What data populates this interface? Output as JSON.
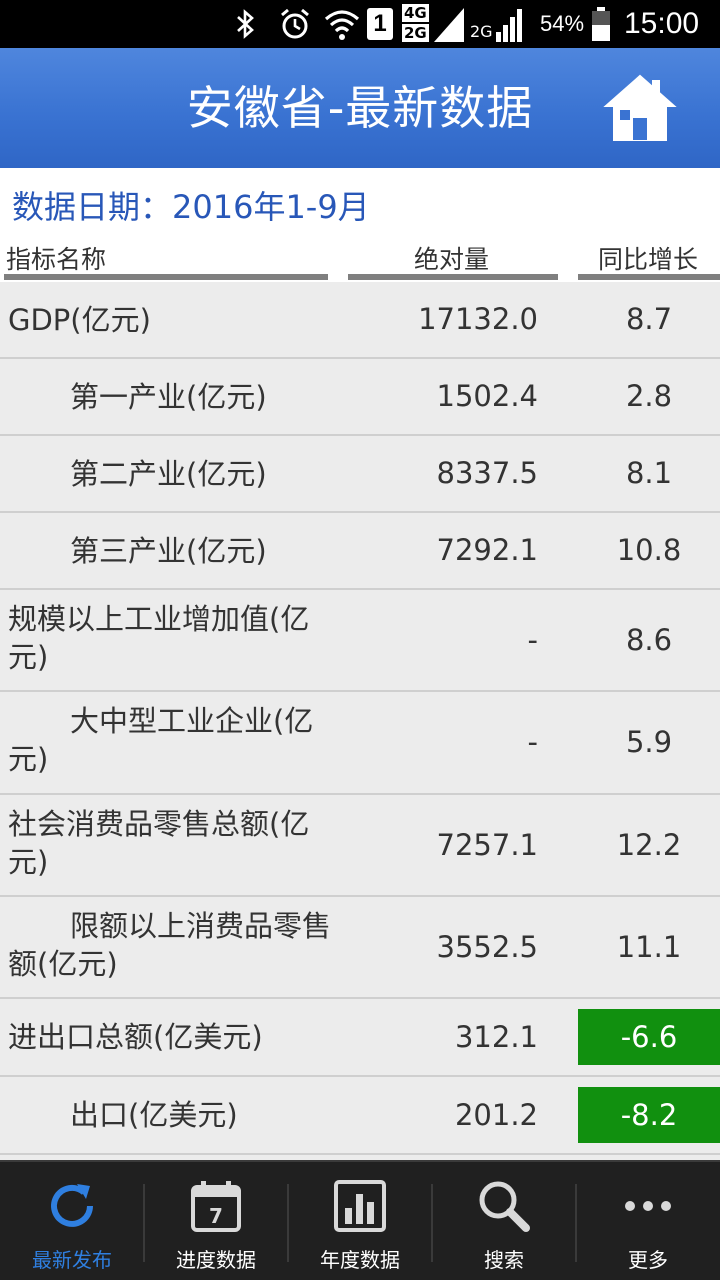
{
  "status_bar": {
    "battery": "54%",
    "time": "15:00",
    "sim_slot": "1",
    "network_top": "4G",
    "network_bottom": "2G",
    "network_2": "2G"
  },
  "header": {
    "title": "安徽省-最新数据",
    "home_icon": "home-icon"
  },
  "date_line": "数据日期：2016年1-9月",
  "columns": {
    "name": "指标名称",
    "value": "绝对量",
    "growth": "同比增长"
  },
  "rows": [
    {
      "name": "GDP(亿元)",
      "value": "17132.0",
      "growth": "8.7",
      "indent": false,
      "negative": false
    },
    {
      "name": "第一产业(亿元)",
      "value": "1502.4",
      "growth": "2.8",
      "indent": true,
      "negative": false
    },
    {
      "name": "第二产业(亿元)",
      "value": "8337.5",
      "growth": "8.1",
      "indent": true,
      "negative": false
    },
    {
      "name": "第三产业(亿元)",
      "value": "7292.1",
      "growth": "10.8",
      "indent": true,
      "negative": false
    },
    {
      "name": "规模以上工业增加值(亿元)",
      "value": "-",
      "growth": "8.6",
      "indent": false,
      "negative": false
    },
    {
      "name": "大中型工业企业(亿元)",
      "value": "-",
      "growth": "5.9",
      "indent": true,
      "negative": false
    },
    {
      "name": "社会消费品零售总额(亿元)",
      "value": "7257.1",
      "growth": "12.2",
      "indent": false,
      "negative": false
    },
    {
      "name": "限额以上消费品零售额(亿元)",
      "value": "3552.5",
      "growth": "11.1",
      "indent": true,
      "negative": false
    },
    {
      "name": "进出口总额(亿美元)",
      "value": "312.1",
      "growth": "-6.6",
      "indent": false,
      "negative": true
    },
    {
      "name": "出口(亿美元)",
      "value": "201.2",
      "growth": "-8.2",
      "indent": true,
      "negative": true
    }
  ],
  "nav": [
    {
      "label": "最新发布",
      "icon": "refresh-icon",
      "active": true
    },
    {
      "label": "进度数据",
      "icon": "calendar-icon",
      "active": false,
      "calendar_day": "7"
    },
    {
      "label": "年度数据",
      "icon": "bar-chart-icon",
      "active": false
    },
    {
      "label": "搜索",
      "icon": "search-icon",
      "active": false
    },
    {
      "label": "更多",
      "icon": "more-icon",
      "active": false
    }
  ],
  "colors": {
    "header_blue": "#3a73d2",
    "date_blue": "#2857b8",
    "negative_green": "#11900f",
    "nav_active": "#2f7fe0"
  }
}
